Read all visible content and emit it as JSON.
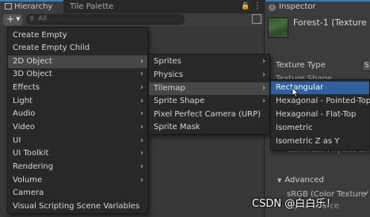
{
  "tabs": {
    "hierarchy": "Hierarchy",
    "tile_palette": "Tile Palette",
    "inspector": "Inspector"
  },
  "icons": {
    "lock": "lock-icon",
    "kebab": "more-options-icon",
    "add": "plus-icon",
    "search": "search-icon",
    "scene": "scene-icon",
    "inspector": "info-icon",
    "submenu": "chevron-right-icon",
    "cursor": "mouse-pointer-icon"
  },
  "toolbar": {
    "add_label": "+",
    "search_placeholder": "All"
  },
  "inspector": {
    "asset_title": "Forest-1 (Texture",
    "texture_type_label": "Texture Type",
    "texture_type_value": "S",
    "texture_shape_label": "Texture Shape",
    "generate_label": "Generate Physics Sh",
    "advanced_label": "Advanced",
    "srgb_label": "sRGB (Color Texture",
    "alpha_label": "Alpha Source"
  },
  "menu1": {
    "items": [
      {
        "label": "Create Empty"
      },
      {
        "label": "Create Empty Child"
      },
      {
        "label": "2D Object"
      },
      {
        "label": "3D Object"
      },
      {
        "label": "Effects"
      },
      {
        "label": "Light"
      },
      {
        "label": "Audio"
      },
      {
        "label": "Video"
      },
      {
        "label": "UI"
      },
      {
        "label": "UI Toolkit"
      },
      {
        "label": "Rendering"
      },
      {
        "label": "Volume"
      },
      {
        "label": "Camera"
      },
      {
        "label": "Visual Scripting Scene Variables"
      }
    ],
    "highlighted": "2D Object"
  },
  "menu2": {
    "items": [
      {
        "label": "Sprites"
      },
      {
        "label": "Physics"
      },
      {
        "label": "Tilemap"
      },
      {
        "label": "Sprite Shape"
      },
      {
        "label": "Pixel Perfect Camera (URP)"
      },
      {
        "label": "Sprite Mask"
      }
    ],
    "highlighted": "Tilemap"
  },
  "menu3": {
    "items": [
      {
        "label": "Rectangular"
      },
      {
        "label": "Hexagonal - Pointed-Top"
      },
      {
        "label": "Hexagonal - Flat-Top"
      },
      {
        "label": "Isometric"
      },
      {
        "label": "Isometric Z as Y"
      }
    ],
    "selected": "Rectangular"
  },
  "watermark": "CSDN @白白乐！",
  "colors": {
    "accent": "#3a79bb",
    "selection": "#2e5f9e",
    "menu_bg": "#282828",
    "panel_bg": "#383838"
  }
}
